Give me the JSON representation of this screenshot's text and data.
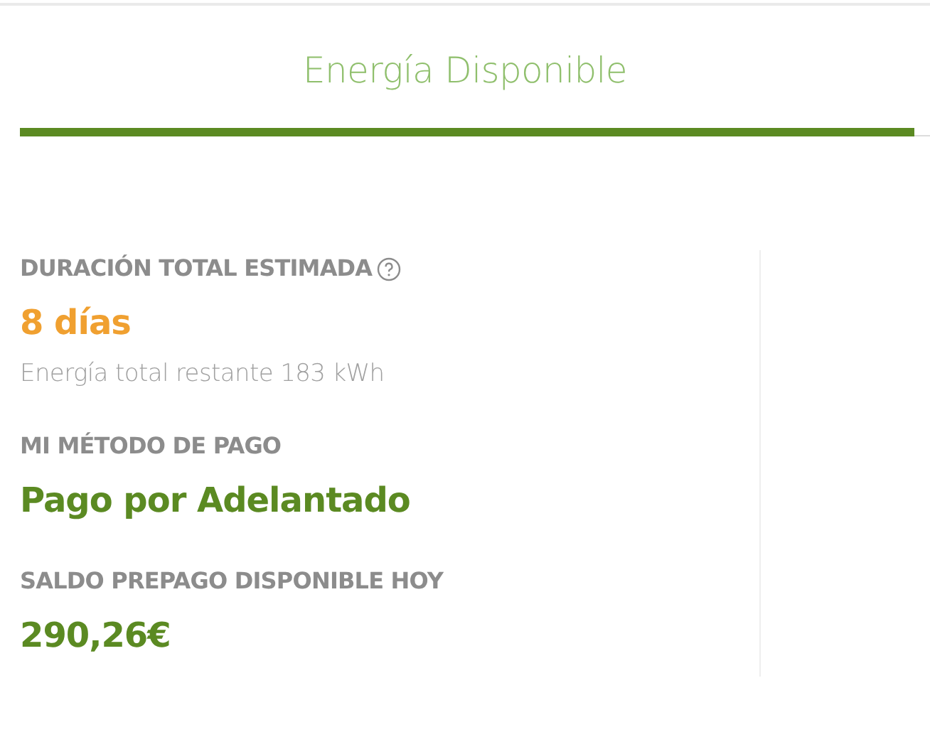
{
  "title": "Energía Disponible",
  "sections": [
    {
      "label": "DURACIÓN TOTAL ESTIMADA",
      "help": true,
      "value": "8 días",
      "color": "#f0a030",
      "note": "Energía total restante 183 kWh"
    },
    {
      "label": "MI MÉTODO DE PAGO",
      "help": false,
      "value": "Pago por Adelantado",
      "color": "#5b8a22"
    },
    {
      "label": "SALDO PREPAGO DISPONIBLE HOY",
      "help": false,
      "value": "290,26€",
      "color": "#5b8a22"
    }
  ]
}
